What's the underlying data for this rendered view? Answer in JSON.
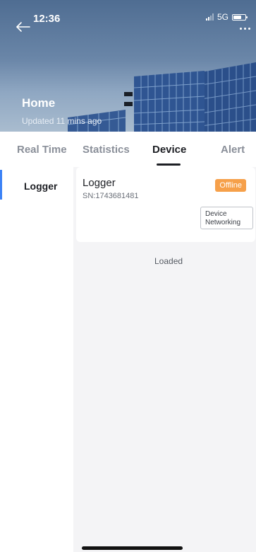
{
  "status_bar": {
    "time": "12:36",
    "network": "5G"
  },
  "hero": {
    "title": "Home",
    "subtitle": "Updated 11 mins ago"
  },
  "tabs": [
    {
      "label": "Real Time",
      "active": false
    },
    {
      "label": "Statistics",
      "active": false
    },
    {
      "label": "Device",
      "active": true
    },
    {
      "label": "Alert",
      "active": false
    }
  ],
  "sidebar": {
    "items": [
      {
        "label": "Logger",
        "selected": true
      }
    ]
  },
  "device_card": {
    "title": "Logger",
    "serial": "SN:1743681481",
    "status": "Offline",
    "action_line1": "Device",
    "action_line2": "Networking"
  },
  "footer": {
    "loaded_text": "Loaded"
  },
  "colors": {
    "accent": "#3b82f6",
    "offline_badge": "#f6a04a",
    "active_tab": "#1d1f24"
  },
  "icons": {
    "back": "back-arrow-icon",
    "more": "more-dots-icon"
  }
}
